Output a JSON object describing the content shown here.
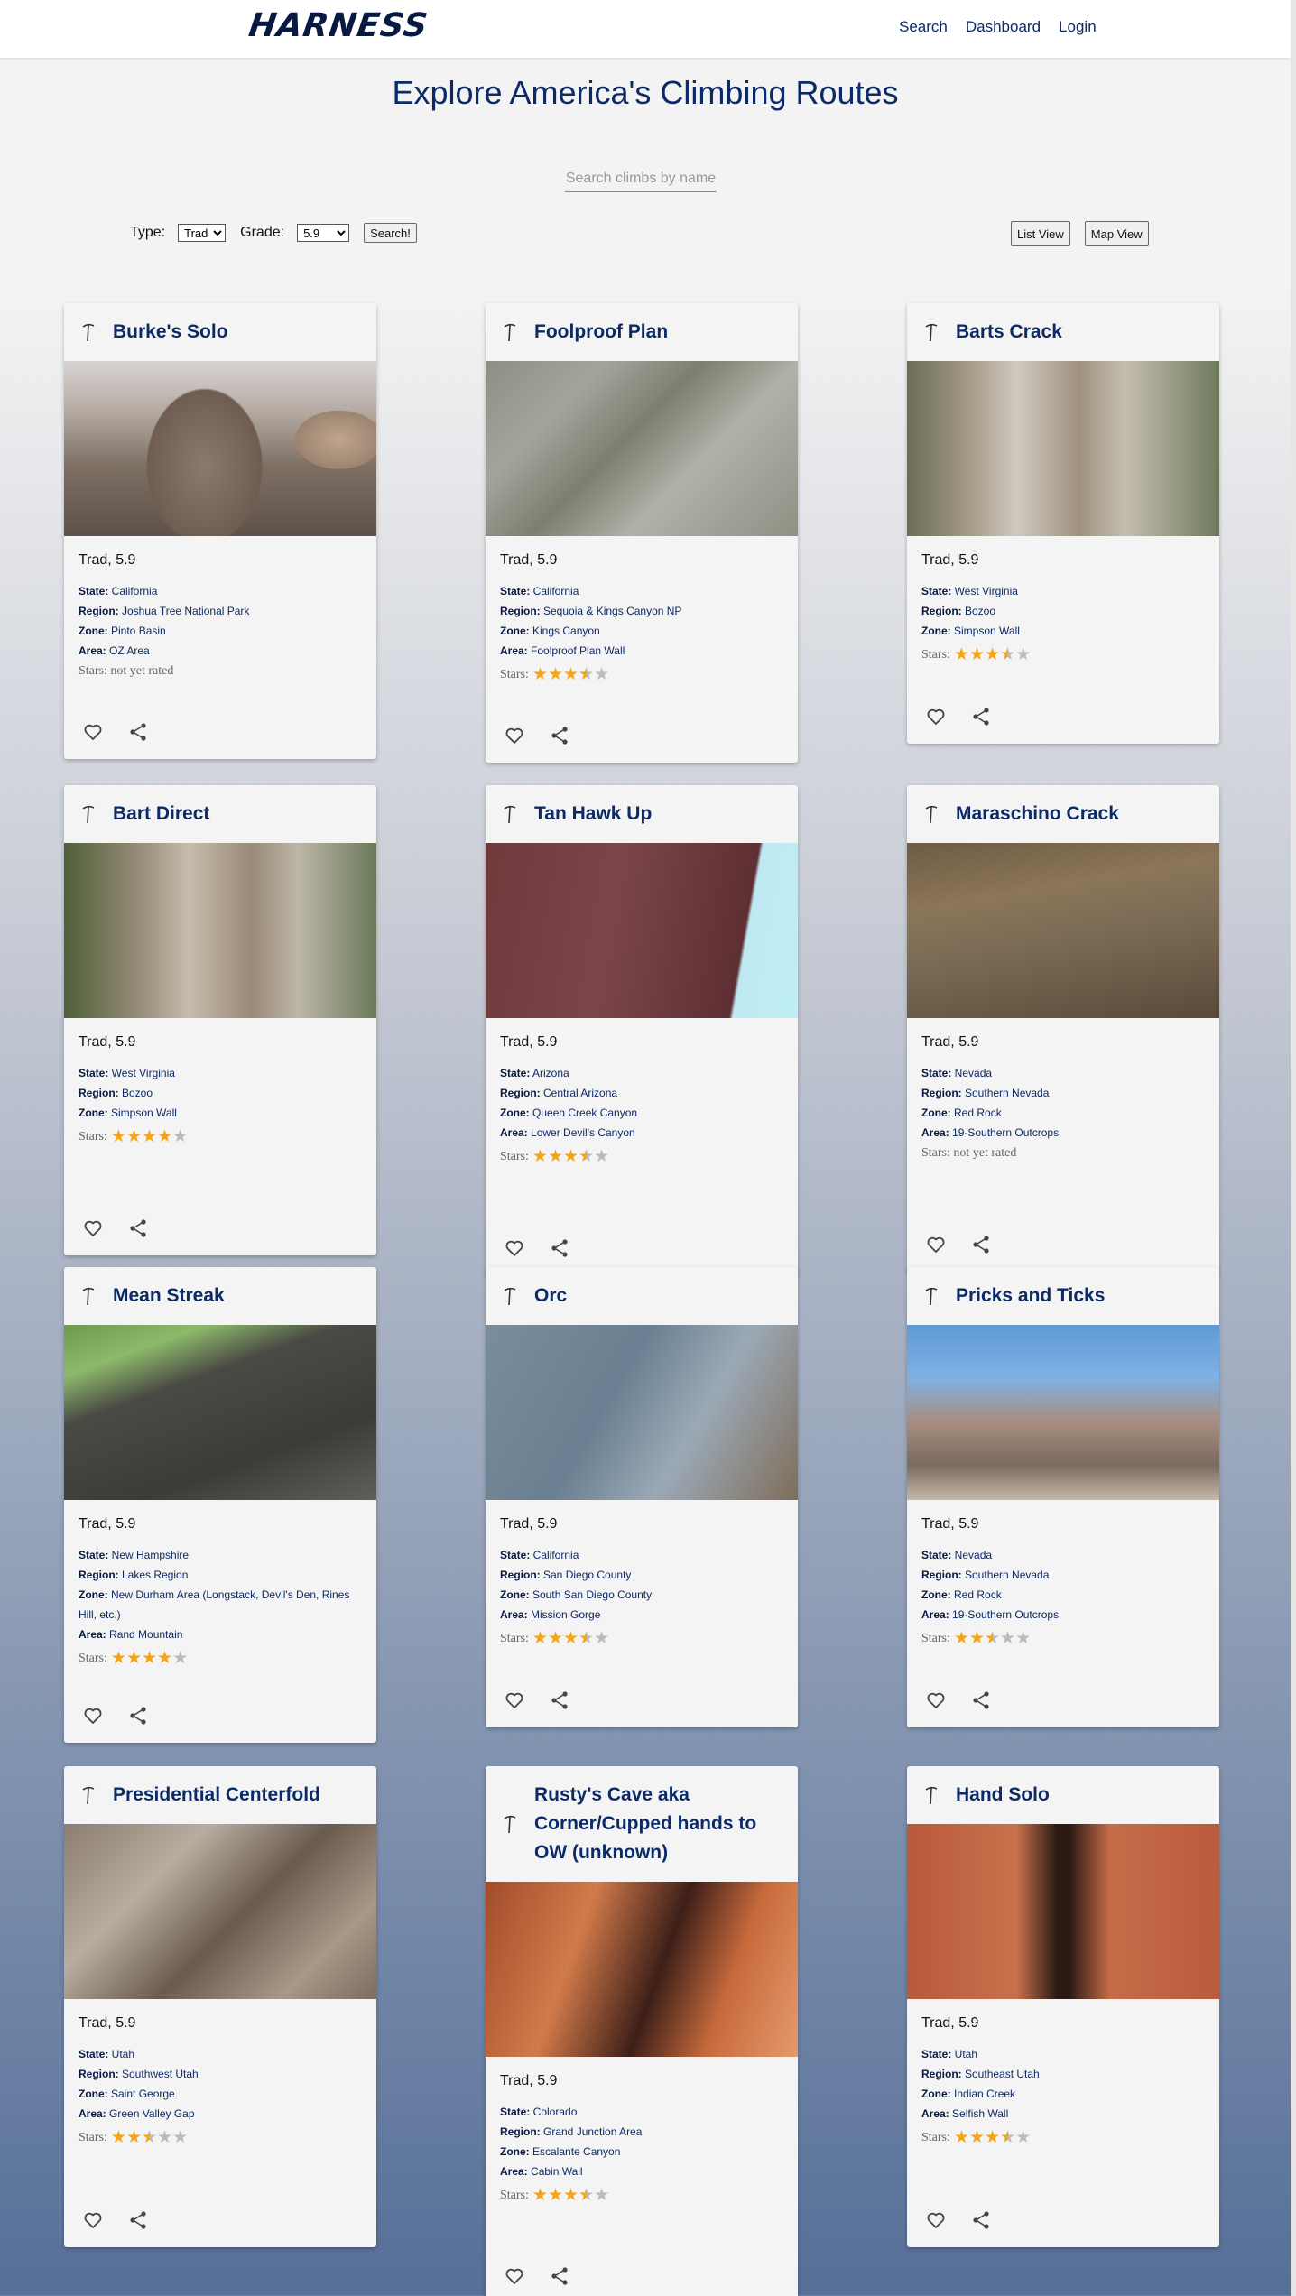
{
  "nav": {
    "logo": "HARNESS",
    "links": [
      "Search",
      "Dashboard",
      "Login"
    ]
  },
  "page": {
    "title": "Explore America's Climbing Routes",
    "search_placeholder": "Search climbs by name"
  },
  "filters": {
    "type_label": "Type:",
    "type_value": "Trad",
    "grade_label": "Grade:",
    "grade_value": "5.9",
    "search_button": "Search!",
    "list_view_button": "List View",
    "map_view_button": "Map View"
  },
  "labels": {
    "state": "State:",
    "region": "Region:",
    "zone": "Zone:",
    "area": "Area:",
    "stars": "Stars:"
  },
  "climbs": [
    {
      "title": "Burke's Solo",
      "grade": "Trad, 5.9",
      "state": "California",
      "region": "Joshua Tree National Park",
      "zone": "Pinto Basin",
      "area": "OZ Area",
      "rating": null,
      "not_rated_text": "Stars: not yet rated"
    },
    {
      "title": "Foolproof Plan",
      "grade": "Trad, 5.9",
      "state": "California",
      "region": "Sequoia & Kings Canyon NP",
      "zone": "Kings Canyon",
      "area": "Foolproof Plan Wall",
      "rating": 3.5
    },
    {
      "title": "Barts Crack",
      "grade": "Trad, 5.9",
      "state": "West Virginia",
      "region": "Bozoo",
      "zone": "Simpson Wall",
      "area": null,
      "rating": 3.5
    },
    {
      "title": "Bart Direct",
      "grade": "Trad, 5.9",
      "state": "West Virginia",
      "region": "Bozoo",
      "zone": "Simpson Wall",
      "area": null,
      "rating": 4
    },
    {
      "title": "Tan Hawk Up",
      "grade": "Trad, 5.9",
      "state": "Arizona",
      "region": "Central Arizona",
      "zone": "Queen Creek Canyon",
      "area": "Lower Devil's Canyon",
      "rating": 3.5
    },
    {
      "title": "Maraschino Crack",
      "grade": "Trad, 5.9",
      "state": "Nevada",
      "region": "Southern Nevada",
      "zone": "Red Rock",
      "area": "19-Southern Outcrops",
      "rating": null,
      "not_rated_text": "Stars: not yet rated"
    },
    {
      "title": "Mean Streak",
      "grade": "Trad, 5.9",
      "state": "New Hampshire",
      "region": "Lakes Region",
      "zone": "New Durham Area (Longstack, Devil's Den, Rines Hill, etc.)",
      "area": "Rand Mountain",
      "rating": 4
    },
    {
      "title": "Orc",
      "grade": "Trad, 5.9",
      "state": "California",
      "region": "San Diego County",
      "zone": "South San Diego County",
      "area": "Mission Gorge",
      "rating": 3.5
    },
    {
      "title": "Pricks and Ticks",
      "grade": "Trad, 5.9",
      "state": "Nevada",
      "region": "Southern Nevada",
      "zone": "Red Rock",
      "area": "19-Southern Outcrops",
      "rating": 2.5
    },
    {
      "title": "Presidential Centerfold",
      "grade": "Trad, 5.9",
      "state": "Utah",
      "region": "Southwest Utah",
      "zone": "Saint George",
      "area": "Green Valley Gap",
      "rating": 2.5
    },
    {
      "title": "Rusty's Cave aka Corner/Cupped hands to OW (unknown)",
      "grade": "Trad, 5.9",
      "state": "Colorado",
      "region": "Grand Junction Area",
      "zone": "Escalante Canyon",
      "area": "Cabin Wall",
      "rating": 3.5
    },
    {
      "title": "Hand Solo",
      "grade": "Trad, 5.9",
      "state": "Utah",
      "region": "Southeast Utah",
      "zone": "Indian Creek",
      "area": "Selfish Wall",
      "rating": 3.5
    }
  ],
  "colors": {
    "brand": "#071942",
    "link": "#0c2a66",
    "star": "#f5a418",
    "card_bg": "#f4f4f4"
  },
  "icons": [
    "ice-axe-icon",
    "heart-icon",
    "share-icon"
  ]
}
